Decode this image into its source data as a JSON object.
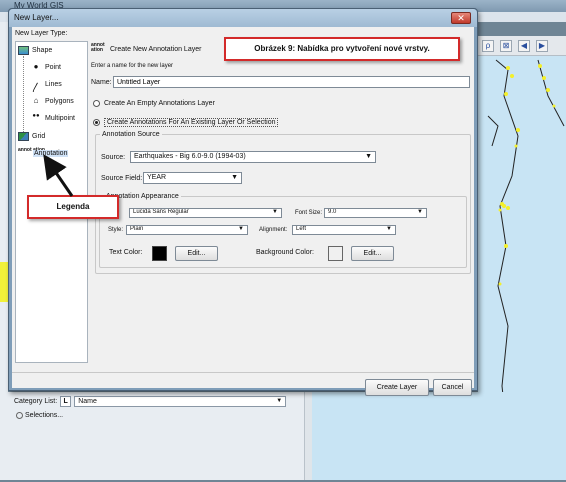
{
  "background_app": {
    "title": "My World GIS",
    "toolbar_icons": [
      "lasso-icon",
      "select-icon",
      "back-icon",
      "forward-icon"
    ],
    "category_list_label": "Category List:",
    "category_icon": "L",
    "category_value": "Name",
    "selections_label": "Selections..."
  },
  "dialog": {
    "title": "New Layer...",
    "close_icon": "close-icon",
    "layer_type_label": "New Layer Type:",
    "layer_types": {
      "shape": "Shape",
      "point": "Point",
      "lines": "Lines",
      "polygons": "Polygons",
      "multipoint": "Multipoint",
      "grid": "Grid",
      "annotation": "Annotation",
      "annotation_icon_text": "annot ation"
    },
    "header_icon_text": "annot ation",
    "header_title": "Create New Annotation Layer",
    "header_instruction": "Enter a name for the new layer",
    "name_label": "Name:",
    "name_value": "Untitled Layer",
    "radio_empty_label": "Create An Empty Annotations Layer",
    "radio_existing_label": "Create Annotations For An Existing Layer Or Selection",
    "radio_selected": "existing",
    "annotation_source": {
      "legend": "Annotation Source",
      "source_label": "Source:",
      "source_value": "Earthquakes - Big 6.0-9.0 (1994-03)",
      "source_field_label": "Source Field:",
      "source_field_value": "YEAR"
    },
    "annotation_appearance": {
      "legend": "Annotation Appearance",
      "font_value": "Lucida Sans Regular",
      "font_size_label": "Font Size:",
      "font_size_value": "9.0",
      "style_label": "Style:",
      "style_value": "Plain",
      "alignment_label": "Alignment:",
      "alignment_value": "Left",
      "text_color_label": "Text Color:",
      "text_color": "#000000",
      "text_color_edit": "Edit...",
      "background_color_label": "Background Color:",
      "background_color": "#f0f0f0",
      "background_color_edit": "Edit..."
    },
    "create_button": "Create Layer",
    "cancel_button": "Cancel"
  },
  "callouts": {
    "title": "Obrázek 9: Nabídka pro vytvoření nové vrstvy.",
    "legend": "Legenda",
    "border_color": "#d32a2a"
  }
}
